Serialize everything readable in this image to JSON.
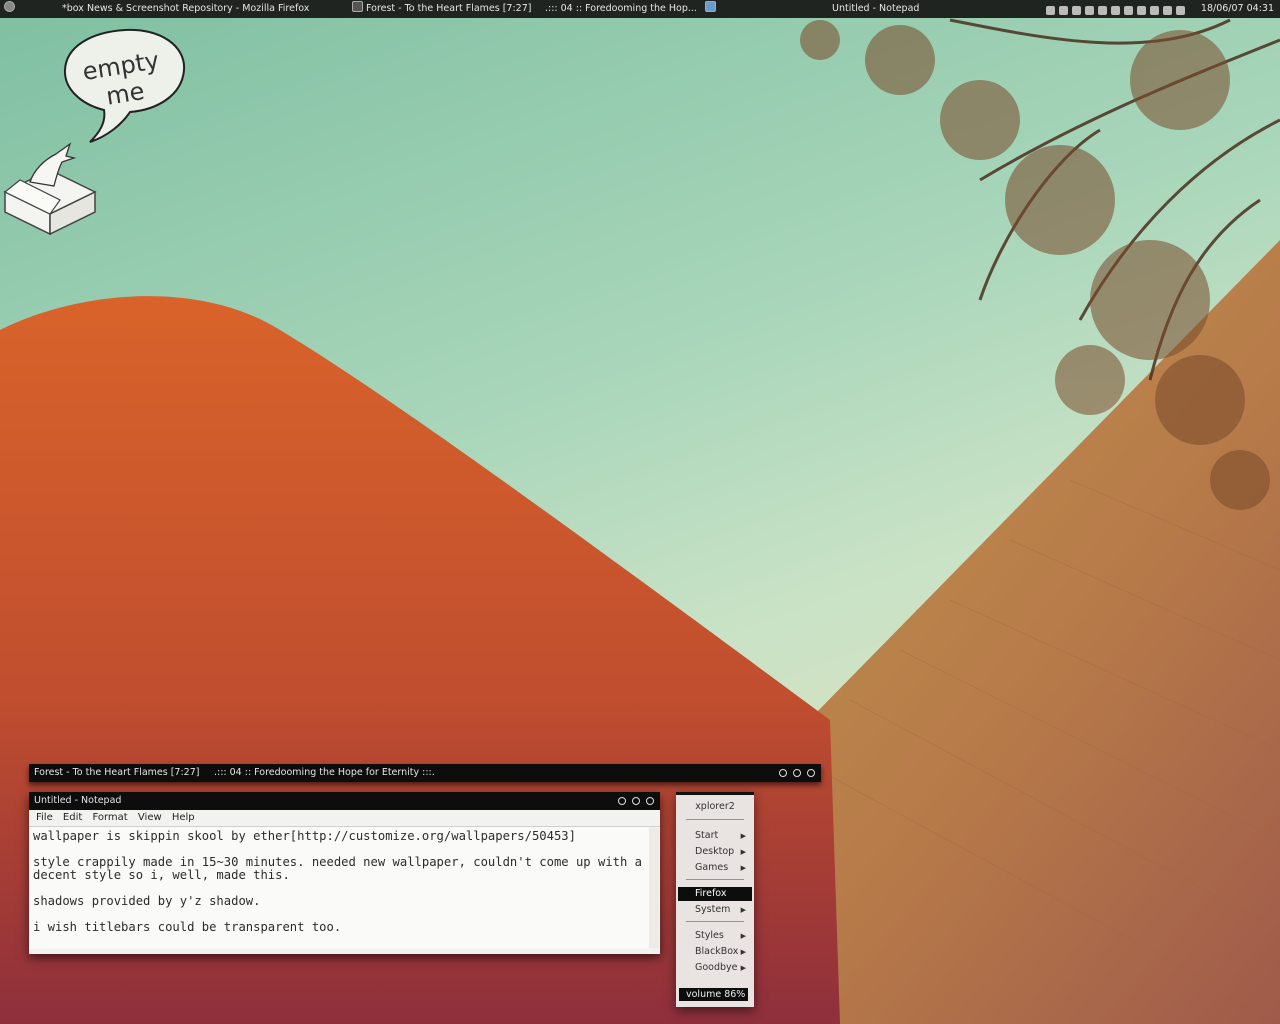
{
  "taskbar": {
    "tasks": [
      {
        "label": "*box News & Screenshot Repository - Mozilla Firefox"
      },
      {
        "label": "Forest - To the Heart Flames [7:27]"
      },
      {
        "label": ".::: 04 :: Foredooming the Hop..."
      },
      {
        "label": "Untitled - Notepad"
      }
    ],
    "clock": "18/06/07 04:31"
  },
  "widget": {
    "bubble_text": "empty me"
  },
  "media_window": {
    "track": "Forest - To the Heart Flames [7:27]",
    "playlist": ".::: 04 :: Foredooming the Hope for Eternity :::."
  },
  "notepad": {
    "title": "Untitled - Notepad",
    "menu": [
      "File",
      "Edit",
      "Format",
      "View",
      "Help"
    ],
    "lines": [
      "wallpaper is skippin skool by ether[http://customize.org/wallpapers/50453]",
      "style crappily made in 15~30 minutes. needed new wallpaper, couldn't come up with a decent style so i, well, made this.",
      "shadows provided by y'z shadow.",
      "i wish titlebars could be transparent too."
    ]
  },
  "blackbox_menu": {
    "title": "xplorer2",
    "items": [
      {
        "label": "Start",
        "submenu": true
      },
      {
        "label": "Desktop",
        "submenu": true
      },
      {
        "label": "Games",
        "submenu": true
      },
      {
        "label": "Firefox",
        "submenu": false,
        "selected": true
      },
      {
        "label": "System",
        "submenu": true
      },
      {
        "label": "Styles",
        "submenu": true
      },
      {
        "label": "BlackBox",
        "submenu": true
      },
      {
        "label": "Goodbye",
        "submenu": true
      }
    ],
    "volume": "volume 86%"
  }
}
